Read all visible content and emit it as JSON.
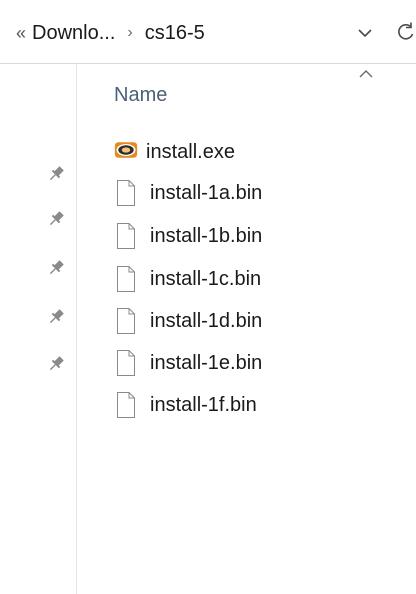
{
  "breadcrumb": {
    "overflow": "«",
    "segments": [
      "Downlo...",
      "cs16-5"
    ],
    "separator": "›"
  },
  "columns": {
    "name_header": "Name",
    "sort": "ascending"
  },
  "files": [
    {
      "name": "install.exe",
      "icon": "setup-exe-icon"
    },
    {
      "name": "install-1a.bin",
      "icon": "blank-file-icon"
    },
    {
      "name": "install-1b.bin",
      "icon": "blank-file-icon"
    },
    {
      "name": "install-1c.bin",
      "icon": "blank-file-icon"
    },
    {
      "name": "install-1d.bin",
      "icon": "blank-file-icon"
    },
    {
      "name": "install-1e.bin",
      "icon": "blank-file-icon"
    },
    {
      "name": "install-1f.bin",
      "icon": "blank-file-icon"
    }
  ],
  "colors": {
    "header_text": "#4c607a",
    "icon_stroke": "#8a8a8a",
    "exe_icon_orange": "#e58a1f"
  }
}
